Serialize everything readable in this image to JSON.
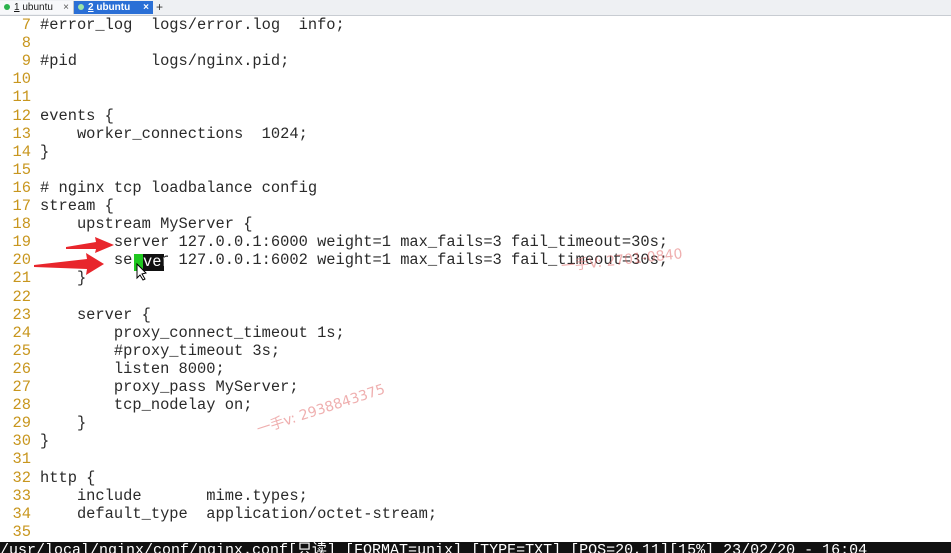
{
  "tabs": [
    {
      "index": "1",
      "label": " ubuntu",
      "close": "×"
    },
    {
      "index": "2",
      "label": " ubuntu",
      "close": "×"
    }
  ],
  "new_tab": "+",
  "lines": [
    {
      "n": "7",
      "text": "#error_log  logs/error.log  info;"
    },
    {
      "n": "8",
      "text": ""
    },
    {
      "n": "9",
      "text": "#pid        logs/nginx.pid;"
    },
    {
      "n": "10",
      "text": ""
    },
    {
      "n": "11",
      "text": ""
    },
    {
      "n": "12",
      "text": "events {"
    },
    {
      "n": "13",
      "text": "    worker_connections  1024;"
    },
    {
      "n": "14",
      "text": "}"
    },
    {
      "n": "15",
      "text": ""
    },
    {
      "n": "16",
      "text": "# nginx tcp loadbalance config"
    },
    {
      "n": "17",
      "text": "stream {"
    },
    {
      "n": "18",
      "text": "    upstream MyServer {"
    },
    {
      "n": "19",
      "text": "        server 127.0.0.1:6000 weight=1 max_fails=3 fail_timeout=30s;"
    },
    {
      "n": "20",
      "text": "        server 127.0.0.1:6002 weight=1 max_fails=3 fail_timeout=30s;"
    },
    {
      "n": "21",
      "text": "    }"
    },
    {
      "n": "22",
      "text": ""
    },
    {
      "n": "23",
      "text": "    server {"
    },
    {
      "n": "24",
      "text": "        proxy_connect_timeout 1s;"
    },
    {
      "n": "25",
      "text": "        #proxy_timeout 3s;"
    },
    {
      "n": "26",
      "text": "        listen 8000;"
    },
    {
      "n": "27",
      "text": "        proxy_pass MyServer;"
    },
    {
      "n": "28",
      "text": "        tcp_nodelay on;"
    },
    {
      "n": "29",
      "text": "    }"
    },
    {
      "n": "30",
      "text": "}"
    },
    {
      "n": "31",
      "text": ""
    },
    {
      "n": "32",
      "text": "http {"
    },
    {
      "n": "33",
      "text": "    include       mime.types;"
    },
    {
      "n": "34",
      "text": "    default_type  application/octet-stream;"
    },
    {
      "n": "35",
      "text": ""
    }
  ],
  "selection_text": "ver",
  "watermarks": [
    "一手v: 2938843375",
    "一手V: 2701-0840"
  ],
  "status_bar": "/usr/local/nginx/conf/nginx.conf[只读] [FORMAT=unix] [TYPE=TXT] [POS=20,11][15%] 23/02/20 - 16:04",
  "colors": {
    "line_number": "#c8961e",
    "arrow": "#e8262c",
    "cursor": "#1fc81f",
    "active_tab": "#2a6fd6"
  }
}
